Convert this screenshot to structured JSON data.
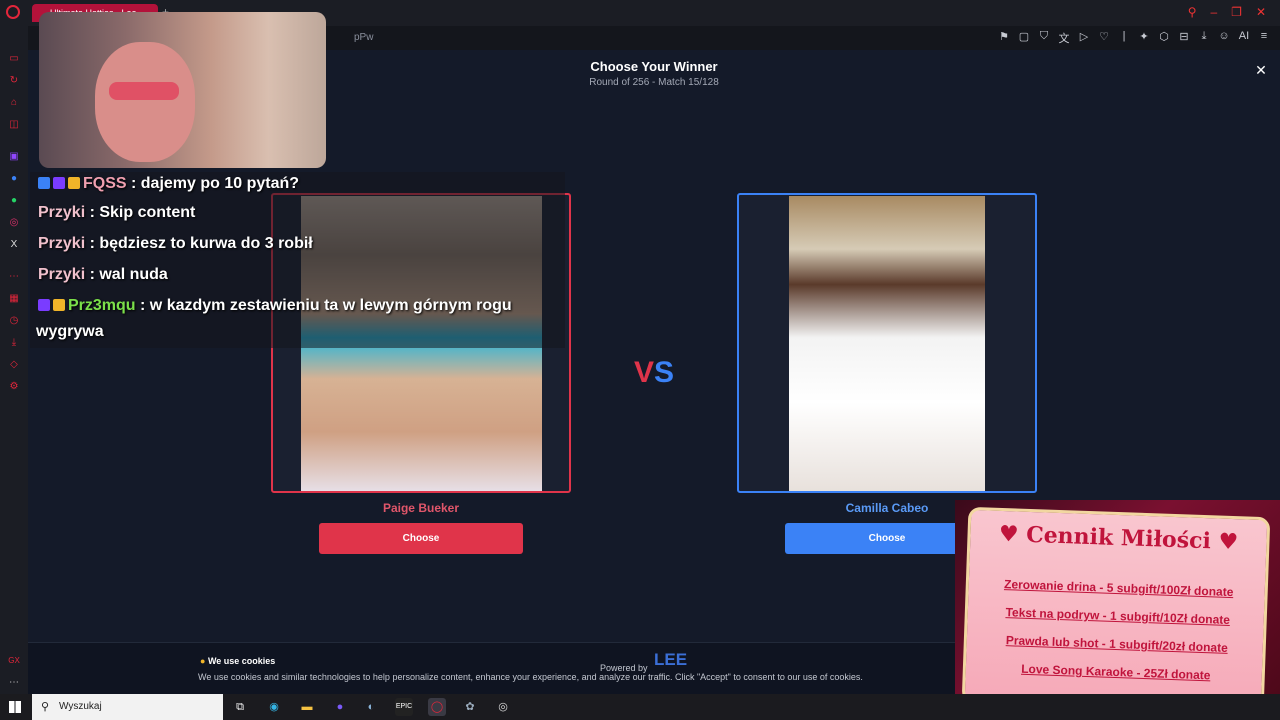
{
  "browser": {
    "tab_title": "Ultimate Hotties - Lee...",
    "url_fragment": "pPw",
    "toolbar_ai_label": "AI"
  },
  "app": {
    "title": "Choose Your Winner",
    "subtitle": "Round of 256 - Match 15/128",
    "close_symbol": "✕",
    "vs_v": "V",
    "vs_s": "S",
    "left": {
      "name": "Paige Bueker",
      "choose_label": "Choose"
    },
    "right": {
      "name": "Camilla Cabeo",
      "choose_label": "Choose"
    },
    "cookie": {
      "title": "We use cookies",
      "text": "We use cookies and similar technologies to help personalize content, enhance your experience, and analyze our traffic. Click \"Accept\" to consent to our use of cookies.",
      "powered_by": "Powered by",
      "logo_text": "LEE"
    }
  },
  "chat": {
    "lines": [
      {
        "user": "FQSS",
        "message": " : dajemy po 10 pytań?"
      },
      {
        "user": "Przyki",
        "message": " : Skip content"
      },
      {
        "user": "Przyki",
        "message": " : będziesz to kurwa do 3 robił"
      },
      {
        "user": "Przyki",
        "message": " : wal nuda"
      },
      {
        "user": "Prz3mqu",
        "message": " : w kazdym zestawieniu ta w lewym górnym rogu"
      },
      {
        "user": "",
        "message": "wygrywa"
      }
    ]
  },
  "pricelist": {
    "title": "Cennik Miłości",
    "items": [
      "Zerowanie drina - 5 subgift/100Zł donate",
      "Tekst na podryw - 1 subgift/10Zł donate",
      "Prawda lub shot - 1 subgift/20zł donate",
      "Love Song Karaoke - 25Zł donate"
    ]
  },
  "taskbar": {
    "search_placeholder": "Wyszukaj"
  },
  "colors": {
    "left_accent": "#e0344a",
    "right_accent": "#3b82f6",
    "background": "#141a29"
  }
}
